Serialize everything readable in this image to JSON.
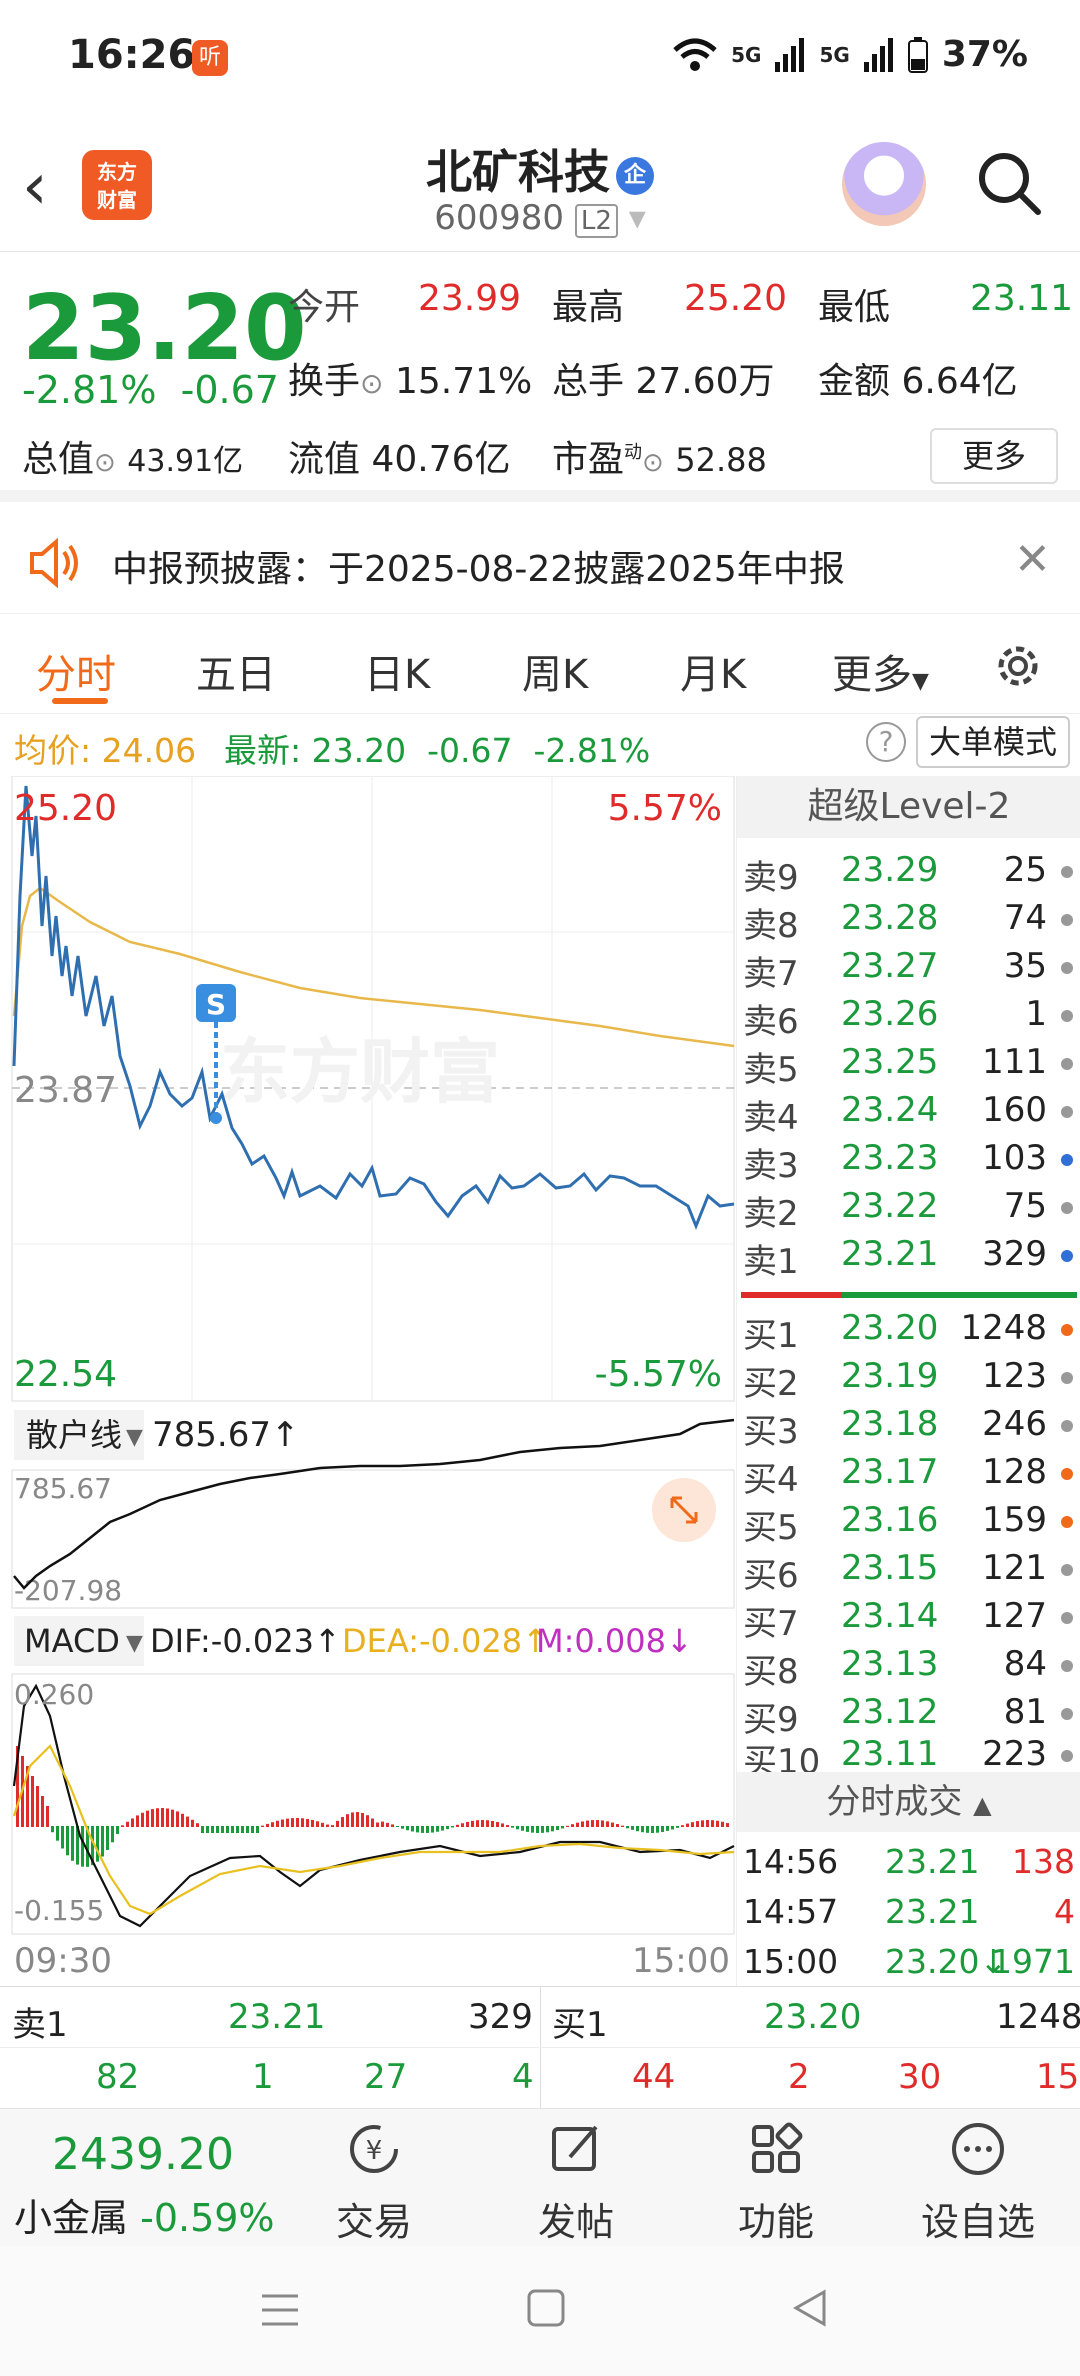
{
  "status": {
    "time": "16:26",
    "ting": "听",
    "battery": "37%",
    "sig1": "5G",
    "sig2": "5G"
  },
  "nav": {
    "name": "北矿科技",
    "qi": "企",
    "code": "600980",
    "level": "L2",
    "logo": "东方\n财富"
  },
  "quote": {
    "price": "23.20",
    "pct": "-2.81%",
    "chg": "-0.67",
    "open_label": "今开",
    "open": "23.99",
    "high_label": "最高",
    "high": "25.20",
    "low_label": "最低",
    "low": "23.11",
    "turnover_label": "换手",
    "turnover": "15.71%",
    "vol_label": "总手",
    "vol": "27.60万",
    "amt_label": "金额",
    "amt": "6.64亿",
    "mv_label": "总值",
    "mv": "43.91亿",
    "fmv_label": "流值",
    "fmv": "40.76亿",
    "pe_label": "市盈",
    "pe_sup": "动",
    "pe": "52.88",
    "more": "更多"
  },
  "notice": {
    "text": "中报预披露：于2025-08-22披露2025年中报"
  },
  "tabs": [
    "分时",
    "五日",
    "日K",
    "周K",
    "月K",
    "更多"
  ],
  "avgbar": {
    "avg_label": "均价:",
    "avg": "24.06",
    "last_label": "最新:",
    "last": "23.20",
    "chg": "-0.67",
    "pct": "-2.81%",
    "help": "?",
    "mode": "大单模式"
  },
  "chart": {
    "top_price": "25.20",
    "top_pct": "5.57%",
    "mid_price": "23.87",
    "bot_price": "22.54",
    "bot_pct": "-5.57%",
    "watermark": "东方财富",
    "retail_label": "散户线",
    "retail_val": "785.67↑",
    "retail_top": "785.67",
    "retail_bot": "-207.98",
    "macd_label": "MACD",
    "dif": "DIF:-0.023↑",
    "dea": "DEA:-0.028↑",
    "m": "M:0.008↓",
    "macd_top": "0.260",
    "macd_bot": "-0.155",
    "t_start": "09:30",
    "t_end": "15:00",
    "s_mark": "S"
  },
  "book": {
    "title": "超级Level-2",
    "asks": [
      {
        "l": "卖9",
        "p": "23.29",
        "q": "25",
        "dot": "#999"
      },
      {
        "l": "卖8",
        "p": "23.28",
        "q": "74",
        "dot": "#999"
      },
      {
        "l": "卖7",
        "p": "23.27",
        "q": "35",
        "dot": "#999"
      },
      {
        "l": "卖6",
        "p": "23.26",
        "q": "1",
        "dot": "#999"
      },
      {
        "l": "卖5",
        "p": "23.25",
        "q": "111",
        "dot": "#999"
      },
      {
        "l": "卖4",
        "p": "23.24",
        "q": "160",
        "dot": "#999"
      },
      {
        "l": "卖3",
        "p": "23.23",
        "q": "103",
        "dot": "#2f6fd6"
      },
      {
        "l": "卖2",
        "p": "23.22",
        "q": "75",
        "dot": "#999"
      },
      {
        "l": "卖1",
        "p": "23.21",
        "q": "329",
        "dot": "#2f6fd6"
      }
    ],
    "bids": [
      {
        "l": "买1",
        "p": "23.20",
        "q": "1248",
        "dot": "#f06a1a"
      },
      {
        "l": "买2",
        "p": "23.19",
        "q": "123",
        "dot": "#999"
      },
      {
        "l": "买3",
        "p": "23.18",
        "q": "246",
        "dot": "#999"
      },
      {
        "l": "买4",
        "p": "23.17",
        "q": "128",
        "dot": "#f06a1a"
      },
      {
        "l": "买5",
        "p": "23.16",
        "q": "159",
        "dot": "#f06a1a"
      },
      {
        "l": "买6",
        "p": "23.15",
        "q": "121",
        "dot": "#999"
      },
      {
        "l": "买7",
        "p": "23.14",
        "q": "127",
        "dot": "#999"
      },
      {
        "l": "买8",
        "p": "23.13",
        "q": "84",
        "dot": "#999"
      },
      {
        "l": "买9",
        "p": "23.12",
        "q": "81",
        "dot": "#999"
      },
      {
        "l": "买10",
        "p": "23.11",
        "q": "223",
        "dot": "#999"
      }
    ],
    "trades_title": "分时成交",
    "trades": [
      {
        "t": "14:56",
        "p": "23.21",
        "v": "138",
        "vc": "#e02b2b"
      },
      {
        "t": "14:57",
        "p": "23.21",
        "v": "4",
        "vc": "#e02b2b"
      },
      {
        "t": "15:00",
        "p": "23.20↓",
        "v": "1971",
        "vc": "#1a9a3a"
      }
    ]
  },
  "l1": {
    "ask_label": "卖1",
    "ask_p": "23.21",
    "ask_q": "329",
    "bid_label": "买1",
    "bid_p": "23.20",
    "bid_q": "1248",
    "ask_sub": [
      "82",
      "1",
      "27",
      "4"
    ],
    "bid_sub": [
      "44",
      "2",
      "30",
      "15"
    ]
  },
  "bnav": {
    "index": "2439.20",
    "index_name": "小金属",
    "index_pct": "-0.59%",
    "items": [
      "交易",
      "发帖",
      "功能",
      "设自选"
    ]
  },
  "colors": {
    "red": "#e02b2b",
    "green": "#1a9a3a",
    "accent": "#f06a1a",
    "price_line": "#2f6fb0",
    "avg_line": "#e8b84a"
  }
}
